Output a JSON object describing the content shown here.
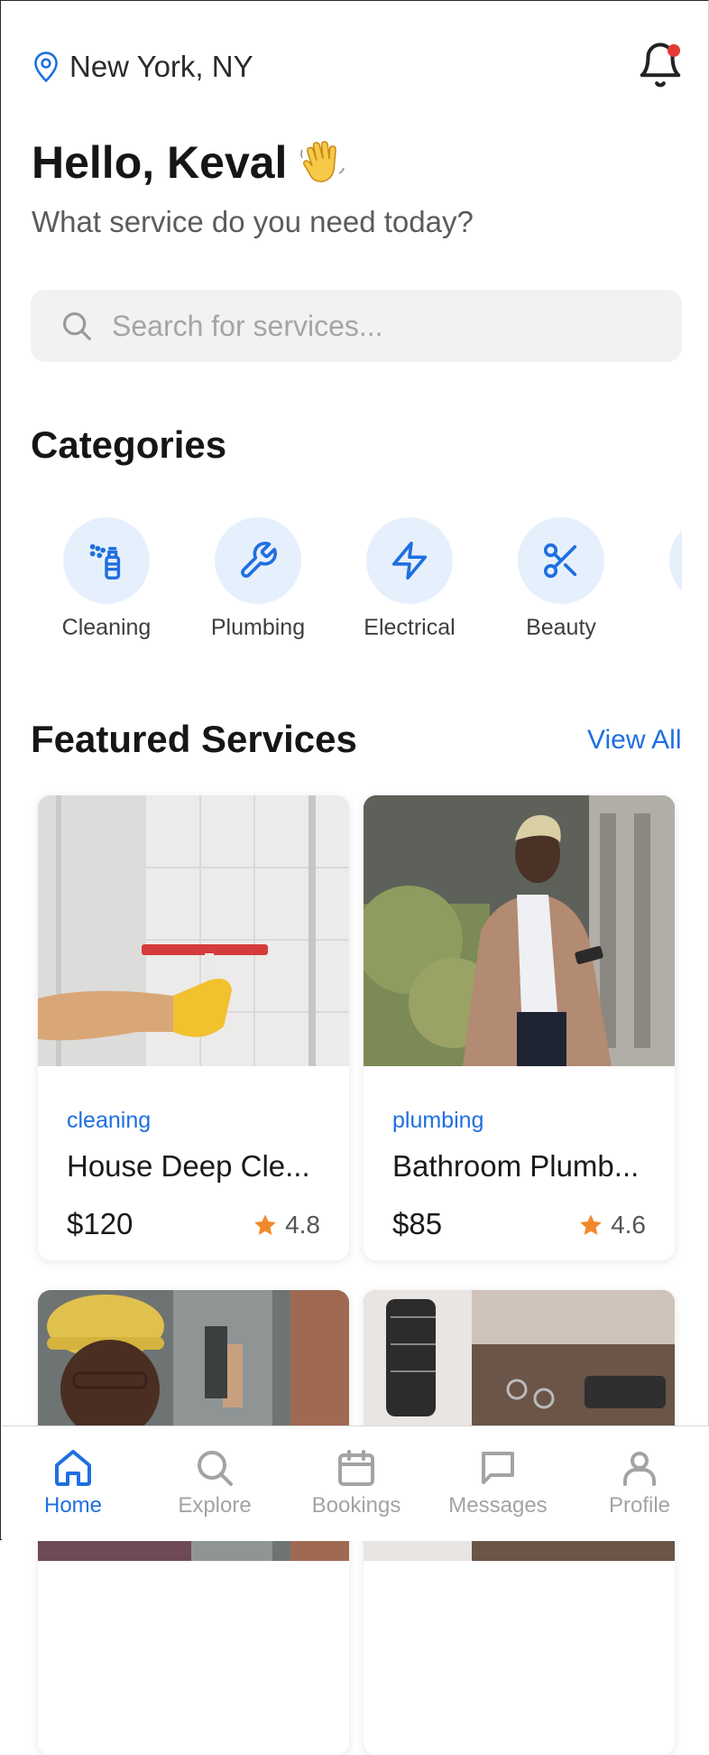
{
  "header": {
    "location": "New York, NY",
    "greeting": "Hello, Keval",
    "subtitle": "What service do you need today?"
  },
  "search": {
    "placeholder": "Search for services..."
  },
  "categories": {
    "title": "Categories",
    "items": [
      {
        "label": "Cleaning",
        "icon": "spray-bottle-icon"
      },
      {
        "label": "Plumbing",
        "icon": "wrench-icon"
      },
      {
        "label": "Electrical",
        "icon": "lightning-icon"
      },
      {
        "label": "Beauty",
        "icon": "scissors-icon"
      }
    ]
  },
  "featured": {
    "title": "Featured Services",
    "view_all": "View All",
    "cards": [
      {
        "category": "cleaning",
        "title": "House Deep Cle...",
        "price": "$120",
        "rating": "4.8"
      },
      {
        "category": "plumbing",
        "title": "Bathroom Plumb...",
        "price": "$85",
        "rating": "4.6"
      },
      {
        "category": "",
        "title": "",
        "price": "",
        "rating": ""
      },
      {
        "category": "",
        "title": "",
        "price": "",
        "rating": ""
      }
    ]
  },
  "nav": {
    "items": [
      {
        "label": "Home",
        "icon": "home-icon",
        "active": true
      },
      {
        "label": "Explore",
        "icon": "search-icon",
        "active": false
      },
      {
        "label": "Bookings",
        "icon": "calendar-icon",
        "active": false
      },
      {
        "label": "Messages",
        "icon": "chat-icon",
        "active": false
      },
      {
        "label": "Profile",
        "icon": "user-icon",
        "active": false
      }
    ]
  },
  "colors": {
    "accent": "#1f6fe0",
    "star": "#f0892b",
    "notification": "#e53935"
  }
}
